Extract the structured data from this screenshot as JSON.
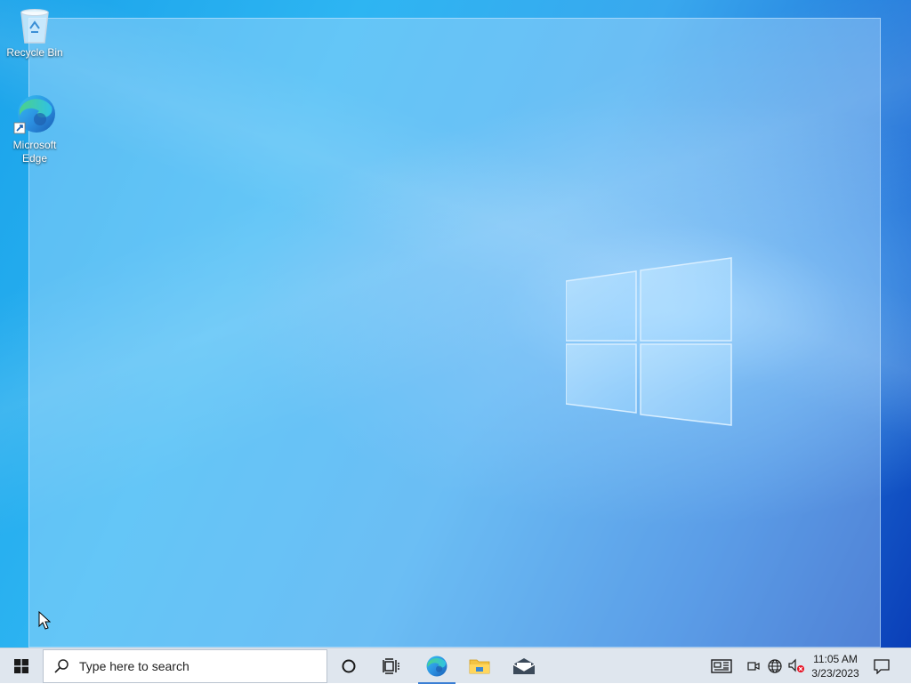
{
  "desktop": {
    "icons": [
      {
        "label": "Recycle Bin",
        "icon": "recycle-bin-icon"
      },
      {
        "label": "Microsoft\nEdge",
        "label_line1": "Microsoft",
        "label_line2": "Edge",
        "icon": "edge-icon"
      }
    ]
  },
  "taskbar": {
    "start_icon": "windows-start-icon",
    "search_placeholder": "Type here to search",
    "pinned": [
      {
        "name": "Cortana",
        "icon": "cortana-icon"
      },
      {
        "name": "Task View",
        "icon": "task-view-icon"
      },
      {
        "name": "Microsoft Edge",
        "icon": "edge-icon",
        "active": true
      },
      {
        "name": "File Explorer",
        "icon": "folder-icon"
      },
      {
        "name": "Mail",
        "icon": "mail-icon"
      }
    ],
    "tray": {
      "news_icon": "news-widget-icon",
      "icons": [
        "meet-now-icon",
        "network-icon",
        "volume-muted-icon"
      ],
      "time": "11:05 AM",
      "date": "3/23/2023",
      "notification_icon": "action-center-icon"
    }
  },
  "colors": {
    "taskbar_bg": "#dfe6ee",
    "accent": "#3b7fd4"
  }
}
